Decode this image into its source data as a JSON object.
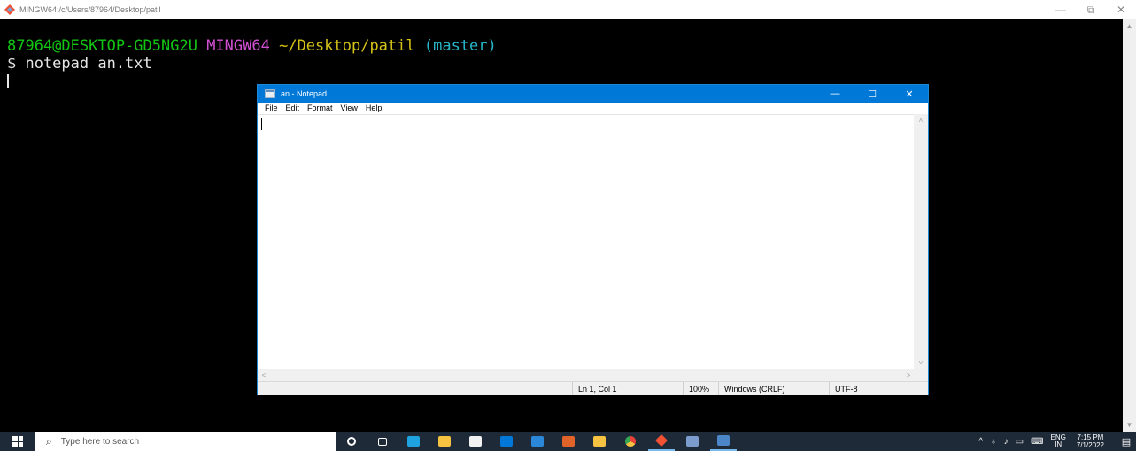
{
  "terminal": {
    "window_title": "MINGW64:/c/Users/87964/Desktop/patil",
    "prompt_user": "87964@DESKTOP-GD5NG2U",
    "prompt_env": "MINGW64",
    "prompt_path": "~/Desktop/patil",
    "prompt_branch": "(master)",
    "command_line": "$ notepad an.txt",
    "scroll_up": "▲",
    "scroll_down": "▼",
    "controls": {
      "minimize": "—",
      "maximize": "⧉",
      "close": "✕"
    }
  },
  "notepad": {
    "title": "an - Notepad",
    "controls": {
      "minimize": "—",
      "maximize": "☐",
      "close": "✕"
    },
    "menu": [
      "File",
      "Edit",
      "Format",
      "View",
      "Help"
    ],
    "content": "",
    "status": {
      "position": "Ln 1, Col 1",
      "zoom": "100%",
      "line_ending": "Windows (CRLF)",
      "encoding": "UTF-8"
    },
    "scroll_up": "˄",
    "scroll_down": "˅",
    "scroll_left": "<",
    "scroll_right": ">"
  },
  "taskbar": {
    "search_placeholder": "Type here to search",
    "search_icon": "⌕",
    "apps": [
      {
        "name": "cortana-icon",
        "color": "#ffffff"
      },
      {
        "name": "task-view-icon",
        "color": "#ffffff"
      },
      {
        "name": "edge-icon",
        "color": "#1fa3e0"
      },
      {
        "name": "file-explorer-icon",
        "color": "#f5c242"
      },
      {
        "name": "store-icon",
        "color": "#f2f2f2"
      },
      {
        "name": "mail-icon",
        "color": "#0078d7"
      },
      {
        "name": "app-blue-icon",
        "color": "#2b88d8"
      },
      {
        "name": "paint-icon",
        "color": "#e0642a"
      },
      {
        "name": "home-icon",
        "color": "#f5c242"
      },
      {
        "name": "chrome-icon",
        "color": "#e94235"
      },
      {
        "name": "git-bash-icon",
        "color": "#f05133"
      },
      {
        "name": "app-monitor-icon",
        "color": "#7b9ccc"
      },
      {
        "name": "notepad-icon",
        "color": "#4a86c8"
      }
    ],
    "tray": {
      "chevron": "^",
      "network_icon": "♁",
      "volume_icon": "♪",
      "battery_icon": "▭",
      "keyboard_icon": "⌨",
      "language": "ENG",
      "language_region": "IN",
      "time": "7:15 PM",
      "date": "7/1/2022",
      "notification_icon": "▤"
    }
  }
}
